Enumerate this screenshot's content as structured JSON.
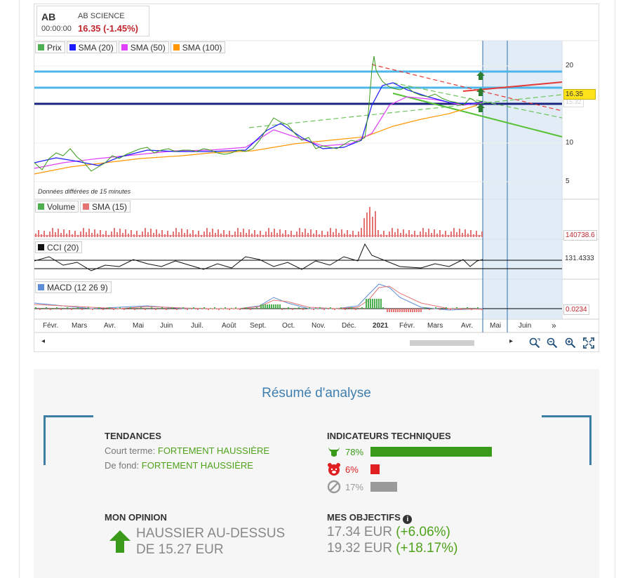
{
  "quote": {
    "symbol": "AB",
    "name": "AB SCIENCE",
    "time": "00:00:00",
    "price_change": "16.35 (-1.45%)"
  },
  "legend_price": [
    {
      "label": "Prix",
      "color": "#4caf50"
    },
    {
      "label": "SMA (20)",
      "color": "#1a1aff"
    },
    {
      "label": "SMA (50)",
      "color": "#e040fb"
    },
    {
      "label": "SMA (100)",
      "color": "#ff9800"
    }
  ],
  "legend_volume": [
    {
      "label": "Volume",
      "color": "#4caf50"
    },
    {
      "label": "SMA (15)",
      "color": "#e57373"
    }
  ],
  "legend_cci": {
    "label": "CCI (20)",
    "color": "#111111"
  },
  "legend_macd": {
    "label": "MACD (12 26 9)",
    "color": "#5c8dd6"
  },
  "price_axis": [
    "20",
    "10",
    "5"
  ],
  "price_tag": "16.35",
  "price_tag_behind": "15.32",
  "volume_tag": "140738.6",
  "cci_tag": "131.4333",
  "macd_tag": "0.0234",
  "delayed_note": "Données différées de 15 minutes",
  "months": [
    "Févr.",
    "Mars",
    "Avr.",
    "Mai",
    "Juin",
    "Juil.",
    "Août",
    "Sept.",
    "Oct.",
    "Nov.",
    "Déc.",
    "2021",
    "Févr.",
    "Mars",
    "Avr.",
    "Mai",
    "Juin"
  ],
  "more_icon": "»",
  "summary": {
    "title": "Résumé d'analyse",
    "trends_heading": "TENDANCES",
    "short_term_label": "Court terme:",
    "short_term_value": "FORTEMENT HAUSSIÈRE",
    "long_term_label": "De fond:",
    "long_term_value": "FORTEMENT HAUSSIÈRE",
    "indicators_heading": "INDICATEURS TECHNIQUES",
    "indicators": [
      {
        "pct": "78%",
        "fraction": 0.78,
        "color": "#3a9b1a",
        "icon": "bull-icon"
      },
      {
        "pct": "6%",
        "fraction": 0.06,
        "color": "#e02020",
        "icon": "bear-icon"
      },
      {
        "pct": "17%",
        "fraction": 0.17,
        "color": "#9a9a9a",
        "icon": "neutral-icon"
      }
    ],
    "opinion_heading": "MON OPINION",
    "opinion_line1": "HAUSSIER AU-DESSUS",
    "opinion_line2": "DE 15.27 EUR",
    "objectives_heading": "MES OBJECTIFS",
    "objective1_value": "17.34 EUR",
    "objective1_change": "(+6.06%)",
    "objective2_value": "19.32 EUR",
    "objective2_change": "(+18.17%)"
  }
}
